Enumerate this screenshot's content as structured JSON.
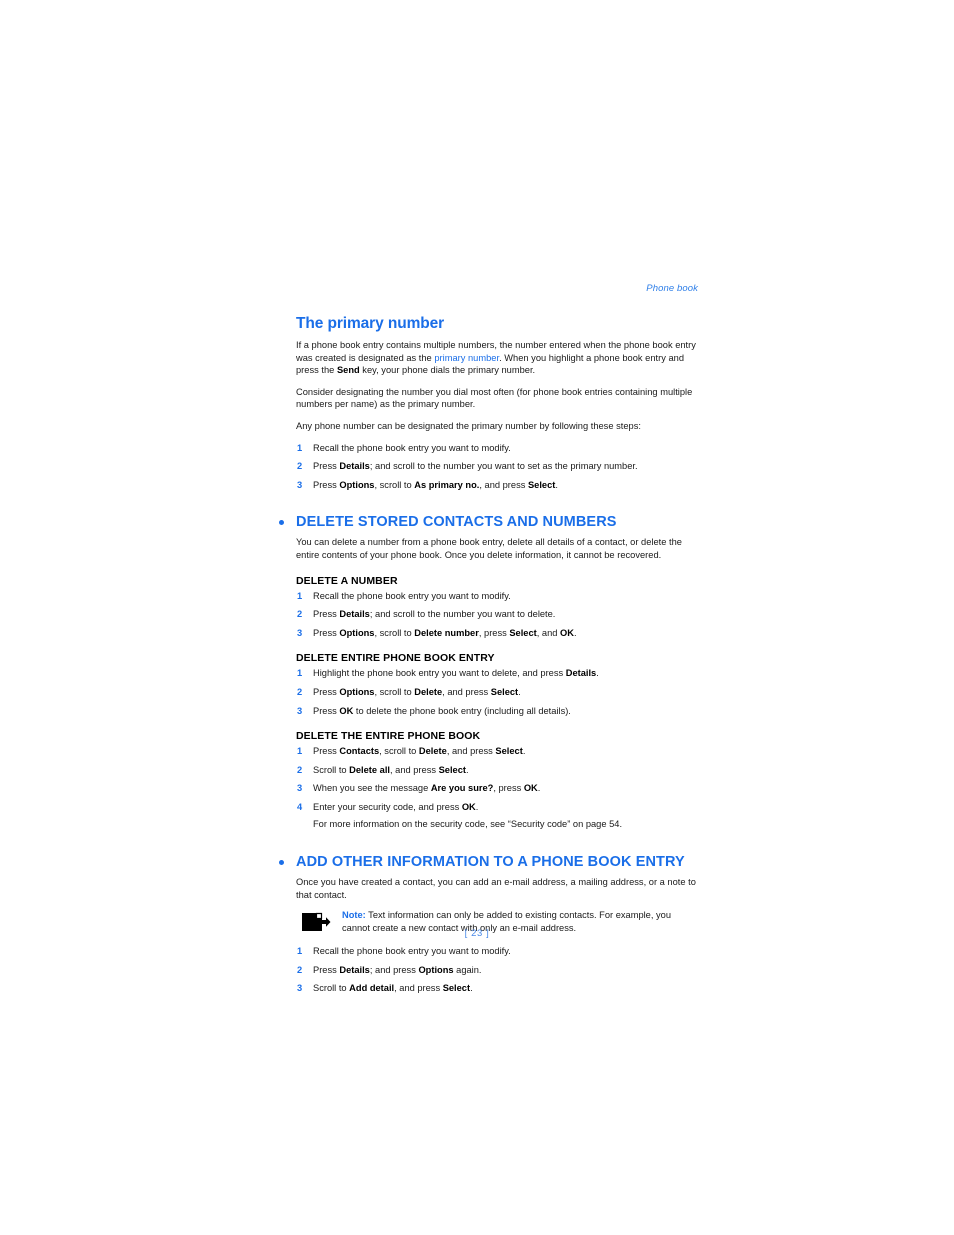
{
  "document": {
    "running_header": "Phone book",
    "page_number": "[ 23 ]"
  },
  "sections": {
    "primary_number": {
      "heading": "The primary number",
      "para1_a": "If a phone book entry contains multiple numbers, the number entered when the phone book entry was created is designated as the ",
      "para1_link": "primary number",
      "para1_b": ". When you highlight a phone book entry and press the ",
      "para1_bold": "Send",
      "para1_c": " key, your phone dials the primary number.",
      "para2": "Consider designating the number you dial most often (for phone book entries containing multiple numbers per name) as the primary number.",
      "para3": "Any phone number can be designated the primary number by following these steps:",
      "steps": [
        {
          "num": "1",
          "a": "Recall the phone book entry you want to modify.",
          "b": "",
          "c": "",
          "d": "",
          "e": ""
        },
        {
          "num": "2",
          "a": "Press ",
          "b": "Details",
          "c": "; and scroll to the number you want to set as the primary number.",
          "d": "",
          "e": ""
        },
        {
          "num": "3",
          "a": "Press ",
          "b": "Options",
          "c": ", scroll to ",
          "d": "As primary no.",
          "e": ", and press ",
          "f": "Select",
          "g": "."
        }
      ]
    },
    "delete_stored": {
      "heading": "DELETE STORED CONTACTS AND NUMBERS",
      "intro": "You can delete a number from a phone book entry, delete all details of a contact, or delete the entire contents of your phone book. Once you delete information, it cannot be recovered.",
      "sub1": {
        "heading": "DELETE A NUMBER",
        "steps": [
          {
            "num": "1",
            "a": "Recall the phone book entry you want to modify."
          },
          {
            "num": "2",
            "a": "Press ",
            "b": "Details",
            "c": "; and scroll to the number you want to delete."
          },
          {
            "num": "3",
            "a": "Press ",
            "b": "Options",
            "c": ", scroll to ",
            "d": "Delete number",
            "e": ", press ",
            "f": "Select",
            "g": ", and ",
            "h": "OK",
            "i": "."
          }
        ]
      },
      "sub2": {
        "heading": "DELETE ENTIRE PHONE BOOK ENTRY",
        "steps": [
          {
            "num": "1",
            "a": "Highlight the phone book entry you want to delete, and press ",
            "b": "Details",
            "c": "."
          },
          {
            "num": "2",
            "a": "Press ",
            "b": "Options",
            "c": ", scroll to ",
            "d": "Delete",
            "e": ", and press ",
            "f": "Select",
            "g": "."
          },
          {
            "num": "3",
            "a": "Press ",
            "b": "OK",
            "c": " to delete the phone book entry (including all details)."
          }
        ]
      },
      "sub3": {
        "heading": "DELETE THE ENTIRE PHONE BOOK",
        "steps": [
          {
            "num": "1",
            "a": "Press ",
            "b": "Contacts",
            "c": ", scroll to ",
            "d": "Delete",
            "e": ", and press ",
            "f": "Select",
            "g": "."
          },
          {
            "num": "2",
            "a": "Scroll to ",
            "b": "Delete all",
            "c": ", and press ",
            "d": "Select",
            "e": "."
          },
          {
            "num": "3",
            "a": "When you see the message ",
            "b": "Are you sure?",
            "c": ", press ",
            "d": "OK",
            "e": "."
          },
          {
            "num": "4",
            "a": "Enter your security code, and press ",
            "b": "OK",
            "c": "."
          }
        ],
        "footnote": "For more information on the security code, see “Security code” on page 54."
      }
    },
    "add_other_info": {
      "heading": "ADD OTHER INFORMATION TO A PHONE BOOK ENTRY",
      "intro": "Once you have created a contact, you can add an e-mail address, a mailing address, or a note to that contact.",
      "note_label": "Note:",
      "note_body": " Text information can only be added to existing contacts. For example, you cannot create a new contact with only an e-mail address.",
      "steps": [
        {
          "num": "1",
          "a": "Recall the phone book entry you want to modify."
        },
        {
          "num": "2",
          "a": "Press ",
          "b": "Details",
          "c": "; and press ",
          "d": "Options",
          "e": " again."
        },
        {
          "num": "3",
          "a": "Scroll to ",
          "b": "Add detail",
          "c": ", and press ",
          "d": "Select",
          "e": "."
        }
      ]
    }
  },
  "colors": {
    "accent_blue": "#1a6ee8",
    "header_blue": "#2f7fe8",
    "body_black": "#1a1a1a"
  }
}
